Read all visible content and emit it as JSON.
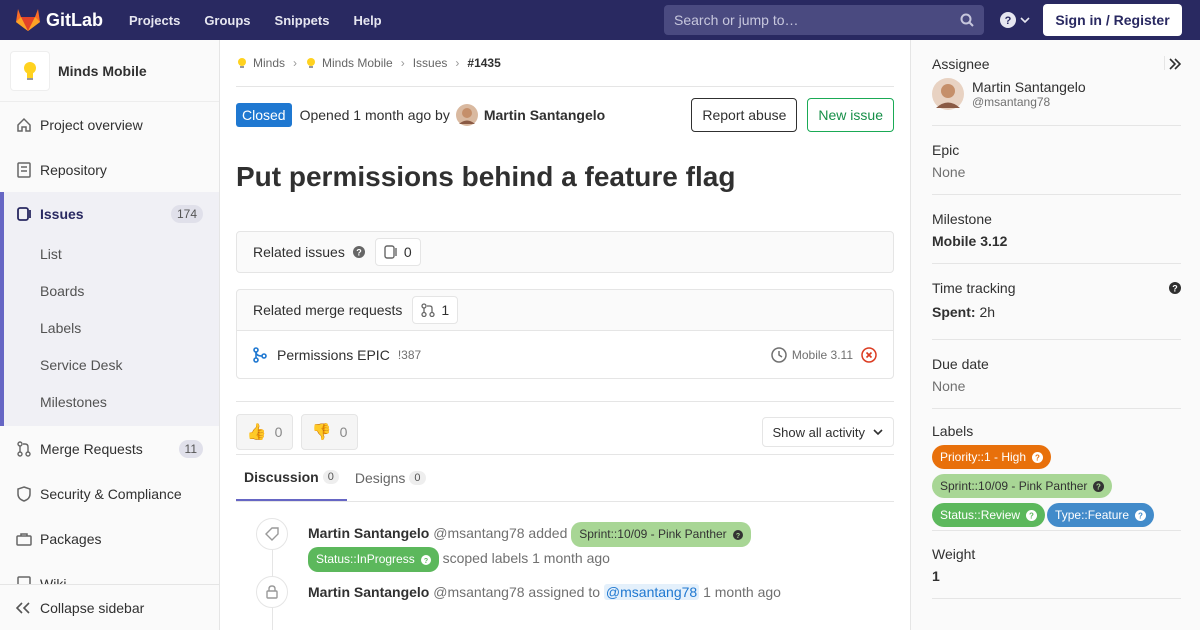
{
  "topbar": {
    "brand": "GitLab",
    "nav": [
      "Projects",
      "Groups",
      "Snippets",
      "Help"
    ],
    "search_placeholder": "Search or jump to…",
    "signin": "Sign in / Register",
    "colors": {
      "bar": "#292961"
    }
  },
  "sidebar": {
    "project_name": "Minds Mobile",
    "items": [
      {
        "label": "Project overview",
        "icon": "home-icon"
      },
      {
        "label": "Repository",
        "icon": "doc-icon"
      },
      {
        "label": "Issues",
        "icon": "issues-icon",
        "badge": "174"
      },
      {
        "label": "Merge Requests",
        "icon": "merge-request-icon",
        "badge": "11"
      },
      {
        "label": "Security & Compliance",
        "icon": "shield-icon"
      },
      {
        "label": "Packages",
        "icon": "package-icon"
      },
      {
        "label": "Wiki",
        "icon": "book-icon"
      }
    ],
    "issues_sub": [
      "List",
      "Boards",
      "Labels",
      "Service Desk",
      "Milestones"
    ],
    "collapse": "Collapse sidebar"
  },
  "breadcrumb": [
    "Minds",
    "Minds Mobile",
    "Issues",
    "#1435"
  ],
  "issue": {
    "status": "Closed",
    "opened_text": "Opened 1 month ago by",
    "author": "Martin Santangelo",
    "report_abuse": "Report abuse",
    "new_issue": "New issue",
    "title": "Put permissions behind a feature flag"
  },
  "related_issues": {
    "label": "Related issues",
    "count": "0"
  },
  "related_mrs": {
    "label": "Related merge requests",
    "count": "1",
    "items": [
      {
        "title": "Permissions EPIC",
        "ref": "!387",
        "milestone": "Mobile 3.11"
      }
    ]
  },
  "awards": {
    "thumbsup": "0",
    "thumbsdown": "0"
  },
  "activity_filter": "Show all activity",
  "tabs": [
    {
      "label": "Discussion",
      "count": "0"
    },
    {
      "label": "Designs",
      "count": "0"
    }
  ],
  "notes": [
    {
      "author": "Martin Santangelo",
      "handle": "@msantang78",
      "action": "added",
      "label1": "Sprint::10/09 - Pink Panther",
      "label2": "Status::InProgress",
      "tail": "scoped labels 1 month ago"
    },
    {
      "author": "Martin Santangelo",
      "handle": "@msantang78",
      "action": "assigned to",
      "target": "@msantang78",
      "time": "1 month ago"
    }
  ],
  "right": {
    "assignee_title": "Assignee",
    "assignee_name": "Martin Santangelo",
    "assignee_handle": "@msantang78",
    "epic_title": "Epic",
    "epic_val": "None",
    "milestone_title": "Milestone",
    "milestone_val": "Mobile 3.12",
    "time_title": "Time tracking",
    "spent_label": "Spent:",
    "spent_val": "2h",
    "due_title": "Due date",
    "due_val": "None",
    "labels_title": "Labels",
    "labels": [
      {
        "text": "Priority::1 - High",
        "color": "#e8700b",
        "fg": "#ffffff"
      },
      {
        "text": "Sprint::10/09 - Pink Panther",
        "color": "#a8d695",
        "fg": "#333333"
      },
      {
        "text": "Status::Review",
        "color": "#5cb85c",
        "fg": "#ffffff"
      },
      {
        "text": "Type::Feature",
        "color": "#428bca",
        "fg": "#ffffff"
      }
    ],
    "weight_title": "Weight",
    "weight_val": "1"
  }
}
